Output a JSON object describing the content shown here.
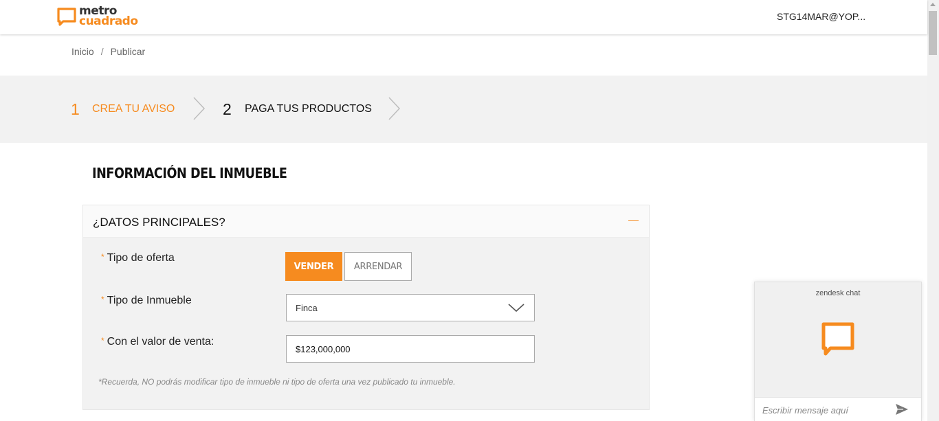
{
  "header": {
    "logo_line1": "metro",
    "logo_line2": "cuadrado",
    "user": "STG14MAR@YOP..."
  },
  "breadcrumb": {
    "items": [
      "Inicio",
      "Publicar"
    ],
    "separator": "/"
  },
  "steps": [
    {
      "number": "1",
      "label": "CREA TU AVISO",
      "active": true
    },
    {
      "number": "2",
      "label": "PAGA TUS PRODUCTOS",
      "active": false
    }
  ],
  "section": {
    "title": "INFORMACIÓN DEL INMUEBLE"
  },
  "panel": {
    "title": "¿DATOS PRINCIPALES?",
    "required_mark": "*",
    "fields": {
      "tipo_oferta": {
        "label": "Tipo de oferta",
        "options": [
          "VENDER",
          "ARRENDAR"
        ],
        "selected": "VENDER"
      },
      "tipo_inmueble": {
        "label": "Tipo de Inmueble",
        "value": "Finca"
      },
      "valor_venta": {
        "label": "Con el valor de venta:",
        "value": "$123,000,000"
      }
    },
    "note": "*Recuerda, NO podrás modificar tipo de inmueble ni tipo de oferta una vez publicado tu inmueble."
  },
  "chat": {
    "title": "zendesk chat",
    "placeholder": "Escribir mensaje aquí"
  },
  "colors": {
    "accent": "#f68b1f",
    "panel_bg": "#f2f2f2"
  }
}
